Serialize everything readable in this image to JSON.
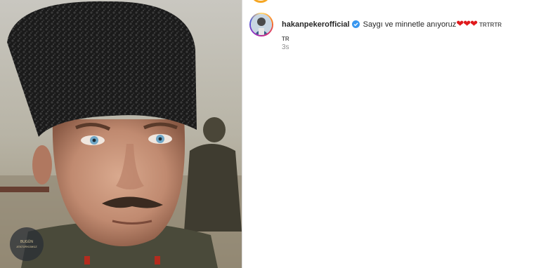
{
  "post": {
    "username": "hakanpekerofficial",
    "caption": "Saygı ve minnetle anıyoruz",
    "hearts": "❤❤❤",
    "tags_line1": "TRTRTR",
    "tags_line2": "TR",
    "time": "3s",
    "image_watermark_text": "BUGÜN ATATÜRKÜMÜZ"
  },
  "colors": {
    "verified": "#3897f0",
    "heart": "#e0191c",
    "story_ring": "#d62976"
  },
  "icons": [
    "verified-badge-icon",
    "heart-emoji-icon"
  ]
}
